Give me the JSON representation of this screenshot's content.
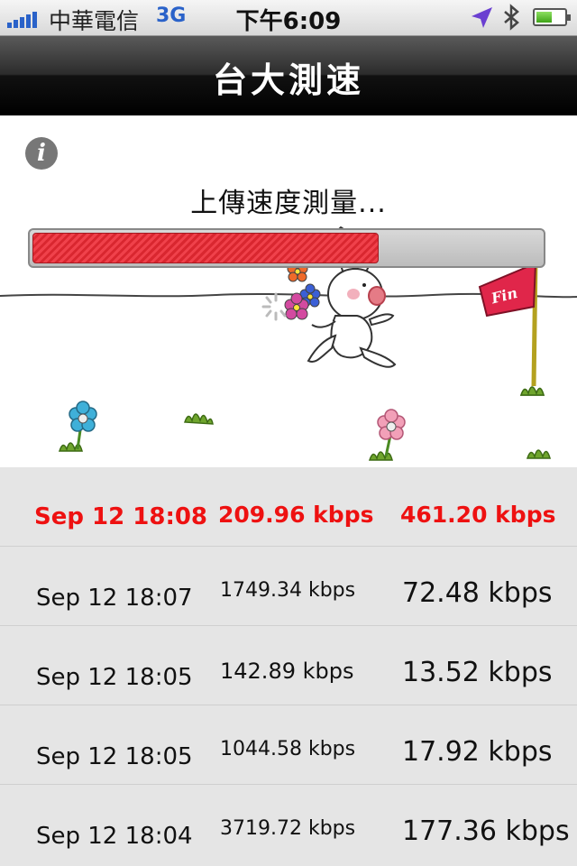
{
  "status_bar": {
    "carrier": "中華電信",
    "network": "3G",
    "time": "下午6:09",
    "battery_level": 0.55,
    "signal_bars": 5
  },
  "nav": {
    "title": "台大測速"
  },
  "test": {
    "message": "上傳速度測量...",
    "progress": 0.68,
    "flag_label": "Fin"
  },
  "results": [
    {
      "date": "Sep 12 18:08",
      "upload": "209.96 kbps",
      "download": "461.20 kbps",
      "highlight": true
    },
    {
      "date": "Sep 12 18:07",
      "upload": "1749.34 kbps",
      "download": "72.48 kbps",
      "highlight": false
    },
    {
      "date": "Sep 12 18:05",
      "upload": "142.89 kbps",
      "download": "13.52 kbps",
      "highlight": false
    },
    {
      "date": "Sep 12 18:05",
      "upload": "1044.58 kbps",
      "download": "17.92 kbps",
      "highlight": false
    },
    {
      "date": "Sep 12 18:04",
      "upload": "3719.72 kbps",
      "download": "177.36 kbps",
      "highlight": false
    }
  ],
  "colors": {
    "highlight": "#ee1111",
    "progress_fill": "#e8343d",
    "accent_blue": "#2a62c9"
  }
}
